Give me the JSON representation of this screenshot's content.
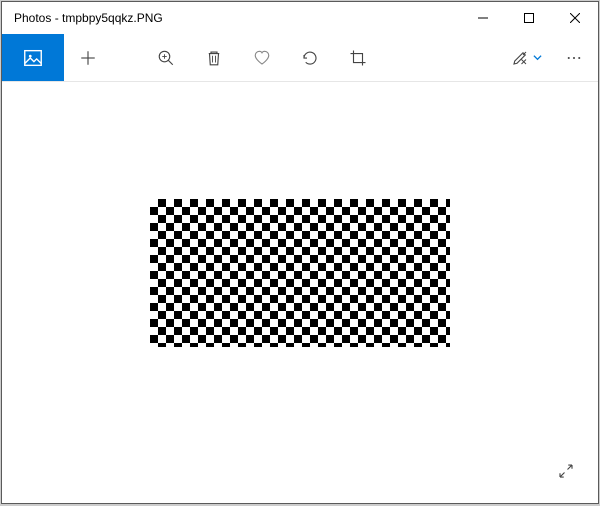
{
  "window": {
    "title": "Photos - tmpbpy5qqkz.PNG"
  },
  "toolbar": {
    "collection_label": "See all photos",
    "add_label": "Add to",
    "zoom_label": "Zoom",
    "delete_label": "Delete",
    "favorite_label": "Favorite",
    "rotate_label": "Rotate",
    "crop_label": "Crop",
    "edit_label": "Edit & Create",
    "more_label": "See more"
  },
  "controls": {
    "minimize": "Minimize",
    "maximize": "Maximize",
    "close": "Close",
    "fullscreen": "Full screen"
  },
  "image": {
    "filename": "tmpbpy5qqkz.PNG",
    "pattern": "checkerboard"
  },
  "colors": {
    "accent": "#0078d7"
  }
}
